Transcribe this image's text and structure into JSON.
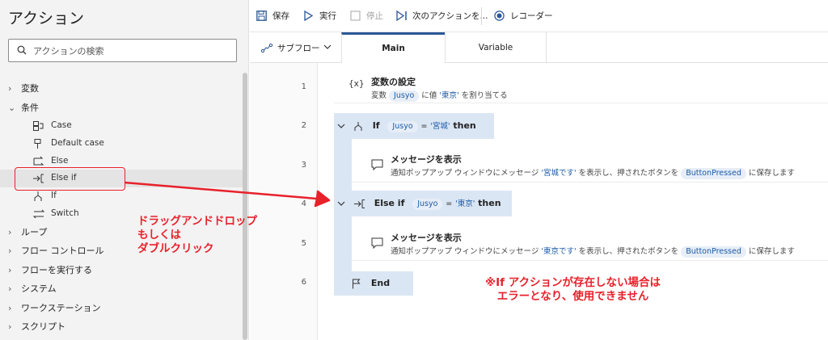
{
  "left_pane": {
    "title": "アクション",
    "search_placeholder": "アクションの検索",
    "categories": [
      {
        "label": "変数",
        "expanded": false
      },
      {
        "label": "条件",
        "expanded": true
      },
      {
        "label": "ループ",
        "expanded": false
      },
      {
        "label": "フロー コントロール",
        "expanded": false
      },
      {
        "label": "フローを実行する",
        "expanded": false
      },
      {
        "label": "システム",
        "expanded": false
      },
      {
        "label": "ワークステーション",
        "expanded": false
      },
      {
        "label": "スクリプト",
        "expanded": false
      }
    ],
    "condition_items": [
      {
        "label": "Case",
        "icon": "case-icon"
      },
      {
        "label": "Default case",
        "icon": "default-case-icon"
      },
      {
        "label": "Else",
        "icon": "else-icon"
      },
      {
        "label": "Else if",
        "icon": "else-if-icon"
      },
      {
        "label": "If",
        "icon": "if-icon"
      },
      {
        "label": "Switch",
        "icon": "switch-icon"
      }
    ]
  },
  "toolbar": {
    "save": "保存",
    "run": "実行",
    "stop": "停止",
    "next": "次のアクションを...",
    "recorder": "レコーダー"
  },
  "tabs": {
    "subflow": "サブフロー",
    "items": [
      "Main",
      "Variable"
    ],
    "active": "Main"
  },
  "steps": {
    "line_numbers": [
      "1",
      "2",
      "3",
      "4",
      "5",
      "6"
    ],
    "s1": {
      "title": "変数の設定",
      "desc_pre": "変数",
      "var": "Jusyo",
      "desc_mid": "に値",
      "value": "'東京'",
      "desc_post": "を割り当てる"
    },
    "s2": {
      "keyword": "If",
      "var": "Jusyo",
      "op": "=",
      "value": "'宮城'",
      "then": "then"
    },
    "s3": {
      "title": "メッセージを表示",
      "desc_pre": "通知ポップアップ ウィンドウにメッセージ",
      "value": "'宮城です'",
      "desc_mid": "を表示し、押されたボタンを",
      "var": "ButtonPressed",
      "desc_post": "に保存します"
    },
    "s4": {
      "keyword": "Else if",
      "var": "Jusyo",
      "op": "=",
      "value": "'東京'",
      "then": "then"
    },
    "s5": {
      "title": "メッセージを表示",
      "desc_pre": "通知ポップアップ ウィンドウにメッセージ",
      "value": "'東京です'",
      "desc_mid": "を表示し、押されたボタンを",
      "var": "ButtonPressed",
      "desc_post": "に保存します"
    },
    "s6": {
      "keyword": "End"
    }
  },
  "annotations": {
    "note1": "ドラッグアンドドロップ\nもしくは\nダブルクリック",
    "note2": "※If アクションが存在しない場合は\nエラーとなり、使用できません"
  },
  "colors": {
    "annotation_red": "#e8212b",
    "accent_blue": "#2b5797",
    "block_blue": "#dbe6f4"
  }
}
